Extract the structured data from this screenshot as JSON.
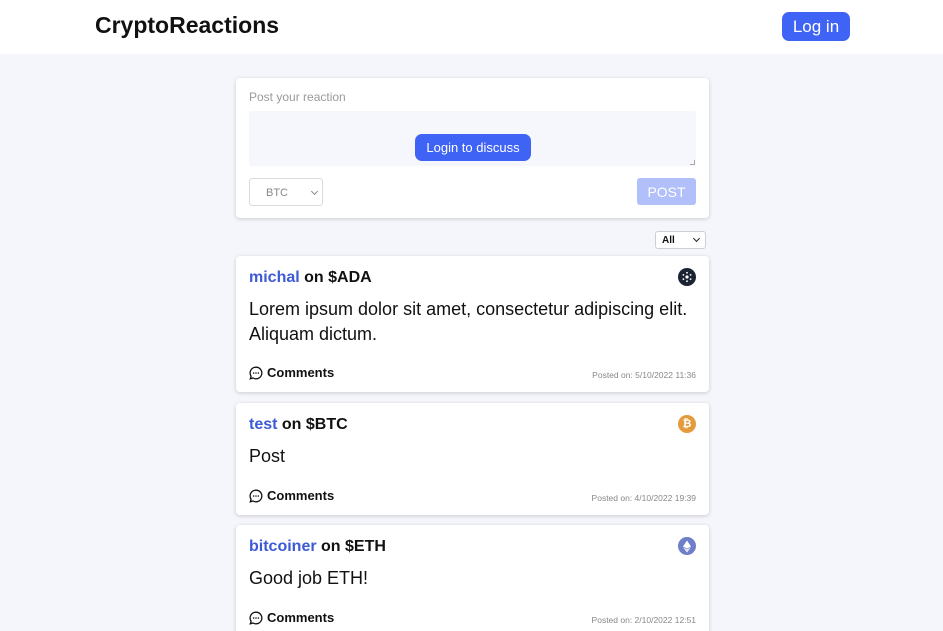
{
  "header": {
    "brand": "CryptoReactions",
    "login_label": "Log in",
    "login_color": "#3e63f5"
  },
  "composer": {
    "label": "Post your reaction",
    "discuss_label": "Login to discuss",
    "coin_selected": "BTC",
    "post_label": "POST"
  },
  "filter": {
    "selected": "All"
  },
  "posts": [
    {
      "user": "michal",
      "on_text": "on $ADA",
      "coin_icon": "cardano-icon",
      "body": "Lorem ipsum dolor sit amet, consectetur adipiscing elit. Aliquam dictum.",
      "comments_label": "Comments",
      "posted": "Posted on: 5/10/2022 11:36"
    },
    {
      "user": "test",
      "on_text": "on $BTC",
      "coin_icon": "bitcoin-icon",
      "body": "Post",
      "comments_label": "Comments",
      "posted": "Posted on: 4/10/2022 19:39"
    },
    {
      "user": "bitcoiner",
      "on_text": "on $ETH",
      "coin_icon": "ethereum-icon",
      "body": "Good job ETH!",
      "comments_label": "Comments",
      "posted": "Posted on: 2/10/2022 12:51"
    }
  ],
  "colors": {
    "accent": "#3e63f5",
    "username": "#3e5bd6",
    "page_bg": "#f5f6fb",
    "btc": "#e39b3c",
    "ada": "#1c2333",
    "eth": "#6f7ec9"
  }
}
